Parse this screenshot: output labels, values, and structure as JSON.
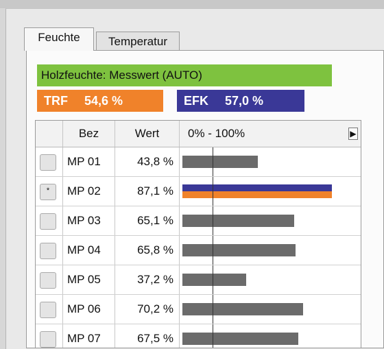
{
  "tabs": [
    {
      "label": "Feuchte",
      "active": true
    },
    {
      "label": "Temperatur",
      "active": false
    }
  ],
  "banner": {
    "text": "Holzfeuchte: Messwert (AUTO)",
    "color": "#7ec23f"
  },
  "trf": {
    "label": "TRF",
    "value": "54,6 %",
    "color": "#f0822a"
  },
  "efk": {
    "label": "EFK",
    "value": "57,0 %",
    "color": "#3a3897"
  },
  "grid": {
    "headers": {
      "bez": "Bez",
      "wert": "Wert",
      "range": "0% - 100%"
    },
    "scroll_icon": "arrow-right-icon",
    "bar_color": "#6b6b6b",
    "rows": [
      {
        "bez": "MP 01",
        "wert": "43,8 %",
        "value": 43.8,
        "selected": false
      },
      {
        "bez": "MP 02",
        "wert": "87,1 %",
        "value": 87.1,
        "selected": true
      },
      {
        "bez": "MP 03",
        "wert": "65,1 %",
        "value": 65.1,
        "selected": false
      },
      {
        "bez": "MP 04",
        "wert": "65,8 %",
        "value": 65.8,
        "selected": false
      },
      {
        "bez": "MP 05",
        "wert": "37,2 %",
        "value": 37.2,
        "selected": false
      },
      {
        "bez": "MP 06",
        "wert": "70,2 %",
        "value": 70.2,
        "selected": false
      },
      {
        "bez": "MP 07",
        "wert": "67,5 %",
        "value": 67.5,
        "selected": false
      }
    ]
  }
}
